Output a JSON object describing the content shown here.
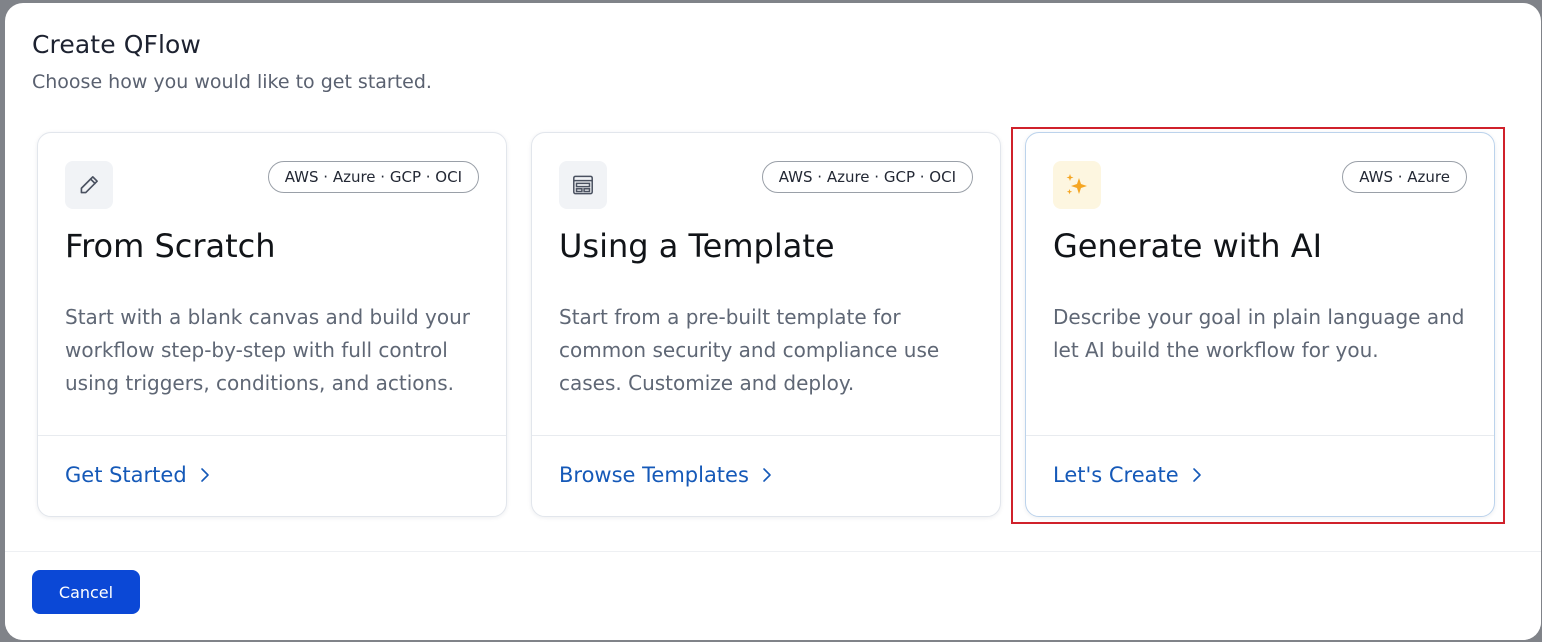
{
  "dialog": {
    "title": "Create QFlow",
    "subtitle": "Choose how you would like to get started."
  },
  "cards": [
    {
      "icon": "pencil-icon",
      "badge": "AWS · Azure · GCP · OCI",
      "title": "From Scratch",
      "description": "Start with a blank canvas and build your workflow step-by-step with full control using triggers, conditions, and actions.",
      "action": "Get Started"
    },
    {
      "icon": "template-icon",
      "badge": "AWS · Azure · GCP · OCI",
      "title": "Using a Template",
      "description": "Start from a pre-built template for common security and compliance use cases. Customize and deploy.",
      "action": "Browse Templates"
    },
    {
      "icon": "sparkles-icon",
      "badge": "AWS · Azure",
      "title": "Generate with AI",
      "description": "Describe your goal in plain language and let AI build the workflow for you.",
      "action": "Let's Create"
    }
  ],
  "footer": {
    "cancel_label": "Cancel"
  },
  "colors": {
    "accent": "#1559b8",
    "primary_button": "#0b48d6",
    "highlight": "#d0212b",
    "ai_icon_gold": "#f5a623"
  }
}
